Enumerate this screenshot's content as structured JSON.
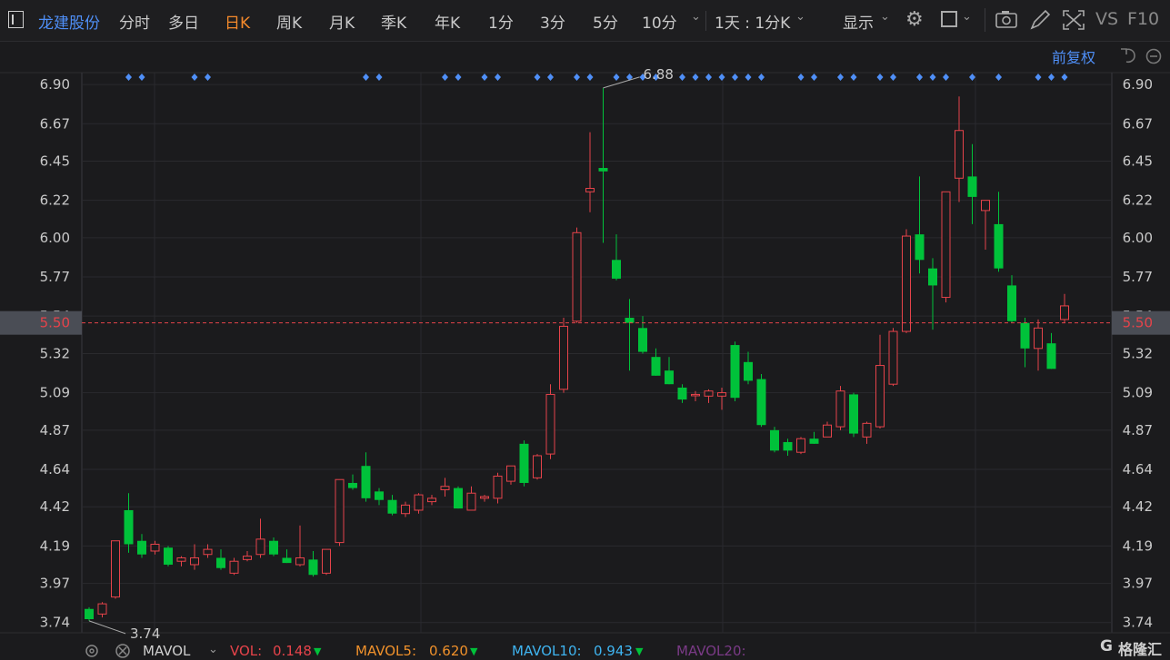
{
  "toolbar": {
    "stock_name": "龙建股份",
    "tabs": [
      {
        "label": "分时",
        "active": false
      },
      {
        "label": "多日",
        "active": false
      },
      {
        "label": "日K",
        "active": true
      },
      {
        "label": "周K",
        "active": false
      },
      {
        "label": "月K",
        "active": false
      },
      {
        "label": "季K",
        "active": false
      },
      {
        "label": "年K",
        "active": false
      },
      {
        "label": "1分",
        "active": false
      },
      {
        "label": "3分",
        "active": false
      },
      {
        "label": "5分",
        "active": false
      },
      {
        "label": "10分",
        "active": false
      }
    ],
    "interval_select": "1天 : 1分K",
    "display_label": "显示",
    "vs_label": "VS",
    "f10_label": "F10"
  },
  "chart_controls": {
    "adjust_label": "前复权"
  },
  "chart_data": {
    "type": "candlestick",
    "title": "",
    "y_ticks": [
      6.9,
      6.67,
      6.45,
      6.22,
      6.0,
      5.77,
      5.54,
      5.32,
      5.09,
      4.87,
      4.64,
      4.42,
      4.19,
      3.97,
      3.74
    ],
    "ylim": [
      3.68,
      6.97
    ],
    "current_price": 5.5,
    "high_label": "6.88",
    "low_label": "3.74",
    "up_color": "#e6434a",
    "down_color": "#00c23a",
    "grid": true,
    "candles": [
      {
        "o": 3.82,
        "h": 3.83,
        "l": 3.75,
        "c": 3.76
      },
      {
        "o": 3.79,
        "h": 3.86,
        "l": 3.77,
        "c": 3.85
      },
      {
        "o": 3.89,
        "h": 4.22,
        "l": 3.88,
        "c": 4.22
      },
      {
        "o": 4.4,
        "h": 4.5,
        "l": 4.15,
        "c": 4.2
      },
      {
        "o": 4.22,
        "h": 4.26,
        "l": 4.12,
        "c": 4.14
      },
      {
        "o": 4.16,
        "h": 4.22,
        "l": 4.14,
        "c": 4.2
      },
      {
        "o": 4.18,
        "h": 4.19,
        "l": 4.07,
        "c": 4.08
      },
      {
        "o": 4.1,
        "h": 4.13,
        "l": 4.07,
        "c": 4.12
      },
      {
        "o": 4.08,
        "h": 4.2,
        "l": 4.05,
        "c": 4.12
      },
      {
        "o": 4.14,
        "h": 4.2,
        "l": 4.12,
        "c": 4.17
      },
      {
        "o": 4.12,
        "h": 4.17,
        "l": 4.05,
        "c": 4.06
      },
      {
        "o": 4.03,
        "h": 4.12,
        "l": 4.02,
        "c": 4.1
      },
      {
        "o": 4.11,
        "h": 4.16,
        "l": 4.1,
        "c": 4.13
      },
      {
        "o": 4.14,
        "h": 4.35,
        "l": 4.12,
        "c": 4.23
      },
      {
        "o": 4.22,
        "h": 4.24,
        "l": 4.13,
        "c": 4.14
      },
      {
        "o": 4.12,
        "h": 4.17,
        "l": 4.09,
        "c": 4.09
      },
      {
        "o": 4.08,
        "h": 4.31,
        "l": 4.07,
        "c": 4.12
      },
      {
        "o": 4.11,
        "h": 4.16,
        "l": 4.01,
        "c": 4.02
      },
      {
        "o": 4.03,
        "h": 4.17,
        "l": 4.02,
        "c": 4.17
      },
      {
        "o": 4.21,
        "h": 4.58,
        "l": 4.19,
        "c": 4.58
      },
      {
        "o": 4.56,
        "h": 4.61,
        "l": 4.52,
        "c": 4.53
      },
      {
        "o": 4.66,
        "h": 4.74,
        "l": 4.45,
        "c": 4.47
      },
      {
        "o": 4.51,
        "h": 4.53,
        "l": 4.43,
        "c": 4.46
      },
      {
        "o": 4.46,
        "h": 4.49,
        "l": 4.37,
        "c": 4.38
      },
      {
        "o": 4.38,
        "h": 4.45,
        "l": 4.36,
        "c": 4.43
      },
      {
        "o": 4.4,
        "h": 4.5,
        "l": 4.38,
        "c": 4.49
      },
      {
        "o": 4.45,
        "h": 4.49,
        "l": 4.43,
        "c": 4.47
      },
      {
        "o": 4.52,
        "h": 4.59,
        "l": 4.48,
        "c": 4.54
      },
      {
        "o": 4.53,
        "h": 4.54,
        "l": 4.41,
        "c": 4.41
      },
      {
        "o": 4.4,
        "h": 4.54,
        "l": 4.4,
        "c": 4.5
      },
      {
        "o": 4.47,
        "h": 4.49,
        "l": 4.45,
        "c": 4.48
      },
      {
        "o": 4.47,
        "h": 4.62,
        "l": 4.44,
        "c": 4.6
      },
      {
        "o": 4.57,
        "h": 4.66,
        "l": 4.55,
        "c": 4.66
      },
      {
        "o": 4.79,
        "h": 4.81,
        "l": 4.54,
        "c": 4.56
      },
      {
        "o": 4.59,
        "h": 4.73,
        "l": 4.58,
        "c": 4.72
      },
      {
        "o": 4.73,
        "h": 5.14,
        "l": 4.7,
        "c": 5.08
      },
      {
        "o": 5.11,
        "h": 5.53,
        "l": 5.09,
        "c": 5.48
      },
      {
        "o": 5.51,
        "h": 6.06,
        "l": 5.5,
        "c": 6.03
      },
      {
        "o": 6.27,
        "h": 6.62,
        "l": 6.15,
        "c": 6.29
      },
      {
        "o": 6.41,
        "h": 6.88,
        "l": 5.97,
        "c": 6.39
      },
      {
        "o": 5.87,
        "h": 6.02,
        "l": 5.75,
        "c": 5.76
      },
      {
        "o": 5.53,
        "h": 5.64,
        "l": 5.22,
        "c": 5.5
      },
      {
        "o": 5.47,
        "h": 5.54,
        "l": 5.32,
        "c": 5.33
      },
      {
        "o": 5.3,
        "h": 5.35,
        "l": 5.19,
        "c": 5.19
      },
      {
        "o": 5.22,
        "h": 5.3,
        "l": 5.14,
        "c": 5.14
      },
      {
        "o": 5.12,
        "h": 5.14,
        "l": 5.03,
        "c": 5.05
      },
      {
        "o": 5.08,
        "h": 5.1,
        "l": 5.04,
        "c": 5.08
      },
      {
        "o": 5.07,
        "h": 5.11,
        "l": 5.03,
        "c": 5.1
      },
      {
        "o": 5.07,
        "h": 5.12,
        "l": 4.99,
        "c": 5.09
      },
      {
        "o": 5.37,
        "h": 5.39,
        "l": 5.04,
        "c": 5.06
      },
      {
        "o": 5.27,
        "h": 5.33,
        "l": 5.14,
        "c": 5.16
      },
      {
        "o": 5.17,
        "h": 5.2,
        "l": 4.89,
        "c": 4.9
      },
      {
        "o": 4.87,
        "h": 4.89,
        "l": 4.74,
        "c": 4.75
      },
      {
        "o": 4.8,
        "h": 4.82,
        "l": 4.72,
        "c": 4.75
      },
      {
        "o": 4.74,
        "h": 4.83,
        "l": 4.73,
        "c": 4.82
      },
      {
        "o": 4.82,
        "h": 4.86,
        "l": 4.79,
        "c": 4.79
      },
      {
        "o": 4.83,
        "h": 4.92,
        "l": 4.83,
        "c": 4.9
      },
      {
        "o": 4.89,
        "h": 5.13,
        "l": 4.87,
        "c": 5.1
      },
      {
        "o": 5.08,
        "h": 5.09,
        "l": 4.83,
        "c": 4.85
      },
      {
        "o": 4.83,
        "h": 4.92,
        "l": 4.79,
        "c": 4.91
      },
      {
        "o": 4.89,
        "h": 5.43,
        "l": 4.88,
        "c": 5.25
      },
      {
        "o": 5.14,
        "h": 5.47,
        "l": 5.13,
        "c": 5.45
      },
      {
        "o": 5.45,
        "h": 6.05,
        "l": 5.44,
        "c": 6.01
      },
      {
        "o": 6.02,
        "h": 6.36,
        "l": 5.79,
        "c": 5.87
      },
      {
        "o": 5.82,
        "h": 5.88,
        "l": 5.46,
        "c": 5.72
      },
      {
        "o": 5.65,
        "h": 6.27,
        "l": 5.62,
        "c": 6.27
      },
      {
        "o": 6.35,
        "h": 6.83,
        "l": 6.21,
        "c": 6.63
      },
      {
        "o": 6.36,
        "h": 6.55,
        "l": 6.08,
        "c": 6.24
      },
      {
        "o": 6.16,
        "h": 6.21,
        "l": 5.93,
        "c": 6.22
      },
      {
        "o": 6.08,
        "h": 6.27,
        "l": 5.8,
        "c": 5.82
      },
      {
        "o": 5.72,
        "h": 5.78,
        "l": 5.5,
        "c": 5.51
      },
      {
        "o": 5.5,
        "h": 5.53,
        "l": 5.24,
        "c": 5.35
      },
      {
        "o": 5.35,
        "h": 5.52,
        "l": 5.22,
        "c": 5.47
      },
      {
        "o": 5.38,
        "h": 5.44,
        "l": 5.23,
        "c": 5.23
      },
      {
        "o": 5.52,
        "h": 5.67,
        "l": 5.5,
        "c": 5.6
      }
    ],
    "event_marker_candles": [
      3,
      4,
      8,
      9,
      21,
      22,
      27,
      28,
      30,
      31,
      34,
      35,
      37,
      38,
      40,
      41,
      42,
      43,
      45,
      46,
      47,
      48,
      49,
      50,
      51,
      54,
      55,
      57,
      58,
      60,
      61,
      63,
      64,
      65,
      67,
      69,
      72,
      73,
      74
    ]
  },
  "footer": {
    "mavol_label": "MAVOL",
    "vol_label": "VOL:",
    "vol_value": "0.148",
    "mavol5_label": "MAVOL5:",
    "mavol5_value": "0.620",
    "mavol10_label": "MAVOL10:",
    "mavol10_value": "0.943",
    "mavol20_label": "MAVOL20:",
    "watermark": "格隆汇"
  },
  "colors": {
    "accent": "#f58a2b",
    "link_blue": "#4f8ff7",
    "up": "#e6434a",
    "down": "#00c23a",
    "vol_red": "#e6434a",
    "mavol5_orange": "#f0912b",
    "mavol10_cyan": "#3fb4f0",
    "mavol20_purple": "#7a3a86"
  }
}
